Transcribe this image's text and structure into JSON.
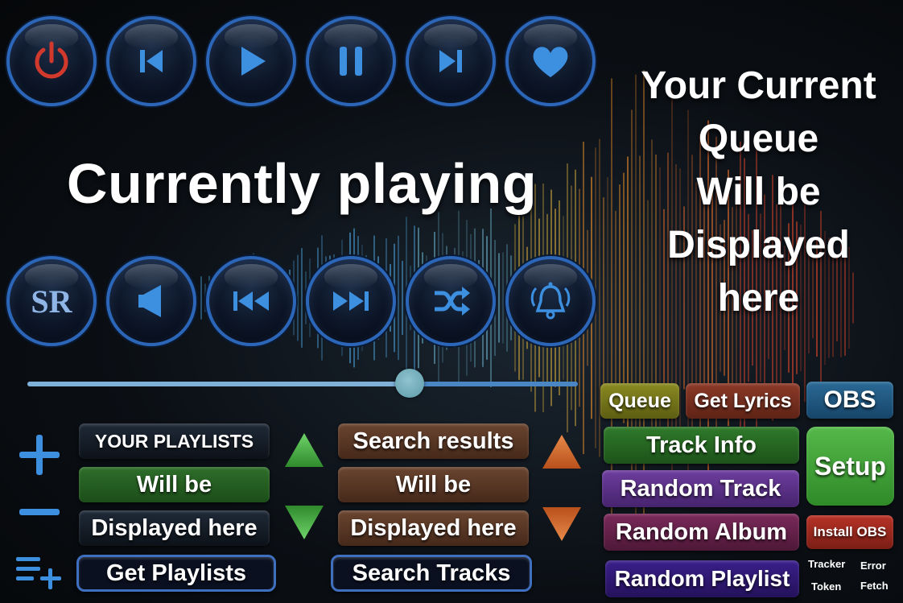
{
  "top_buttons": [
    {
      "icon": "power-icon",
      "color": "#d0392b"
    },
    {
      "icon": "skip-back-icon",
      "color": "#3d8fe0"
    },
    {
      "icon": "play-icon",
      "color": "#3d8fe0"
    },
    {
      "icon": "pause-icon",
      "color": "#3d8fe0"
    },
    {
      "icon": "skip-forward-icon",
      "color": "#3d8fe0"
    },
    {
      "icon": "heart-icon",
      "color": "#3d8fe0"
    }
  ],
  "bottom_buttons": [
    {
      "icon": "sr-text-icon",
      "label": "SR"
    },
    {
      "icon": "volume-icon"
    },
    {
      "icon": "rewind-icon"
    },
    {
      "icon": "fast-forward-icon"
    },
    {
      "icon": "shuffle-icon"
    },
    {
      "icon": "bell-ringing-icon"
    }
  ],
  "now_playing": {
    "title": "Currently playing"
  },
  "queue": {
    "lines": [
      "Your Current",
      "Queue",
      "Will be",
      "Displayed",
      "here"
    ]
  },
  "progress": {
    "fraction": 0.695
  },
  "playlists": {
    "header": "YOUR PLAYLISTS",
    "line2": "Will be",
    "line3": "Displayed here",
    "button": "Get Playlists"
  },
  "search": {
    "header": "Search results",
    "line2": "Will be",
    "line3": "Displayed here",
    "button": "Search Tracks"
  },
  "actions": {
    "queue": "Queue",
    "get_lyrics": "Get Lyrics",
    "obs": "OBS",
    "track_info": "Track Info",
    "setup": "Setup",
    "random_track": "Random Track",
    "random_album": "Random Album",
    "install_obs": "Install OBS",
    "random_playlist": "Random Playlist",
    "tracker_token_1": "Tracker",
    "tracker_token_2": "Token",
    "error_fetch_1": "Error",
    "error_fetch_2": "Fetch"
  },
  "colors": {
    "accent_blue": "#3d8fe0",
    "power_red": "#d0392b",
    "up_arrow_green": "#4cb34a",
    "search_arrow_orange": "#d9682a"
  }
}
